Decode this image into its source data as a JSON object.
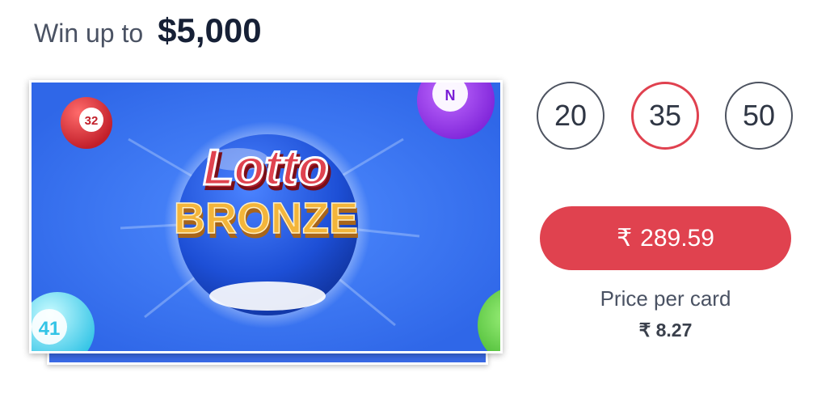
{
  "header": {
    "win_label": "Win up to",
    "win_amount": "$5,000"
  },
  "game": {
    "title_line1": "Lotto",
    "title_line2": "BRONZE",
    "ball_numbers": [
      "32",
      "41"
    ]
  },
  "card_counts": {
    "options": [
      "20",
      "35",
      "50"
    ],
    "selected": "35"
  },
  "buy_button": {
    "currency_symbol": "₹",
    "amount": "289.59"
  },
  "price_per_card": {
    "label": "Price per card",
    "value": "₹ 8.27"
  },
  "colors": {
    "accent": "#e0424f",
    "card_background": "#3472f0",
    "title_red": "#e0424f",
    "title_gold": "#f3b53a"
  }
}
